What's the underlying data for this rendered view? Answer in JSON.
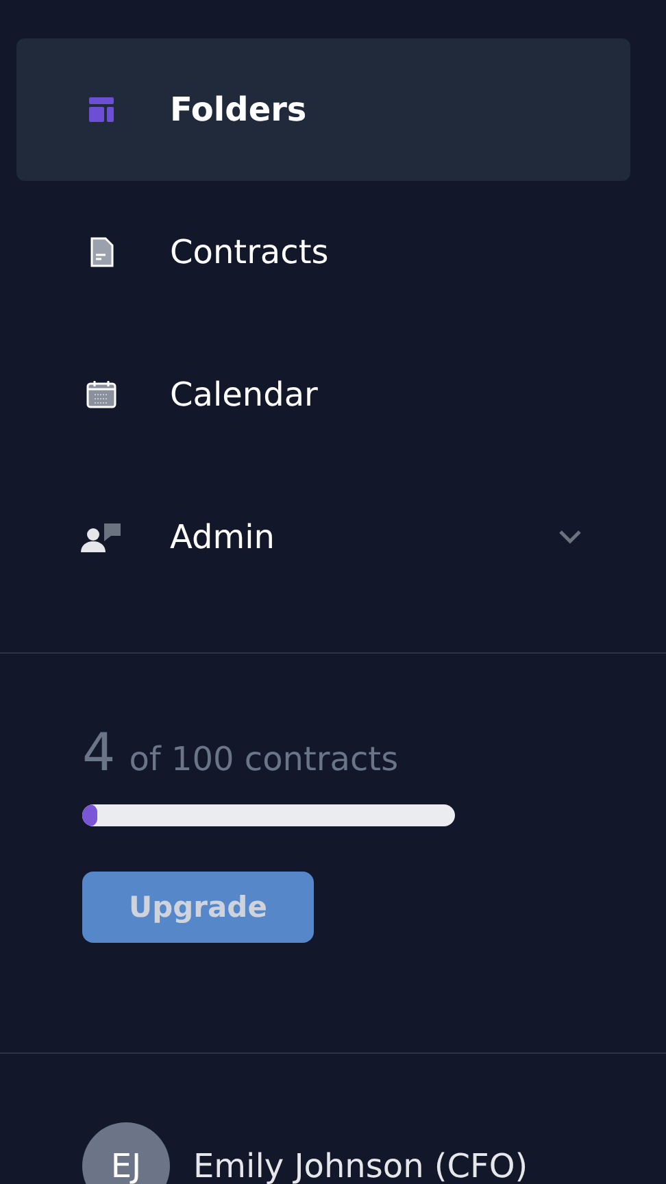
{
  "nav": [
    {
      "label": "Folders",
      "kind": "folders",
      "selected": true
    },
    {
      "label": "Contracts",
      "kind": "document",
      "selected": false
    },
    {
      "label": "Calendar",
      "kind": "calendar",
      "selected": false
    },
    {
      "label": "Admin",
      "kind": "admin",
      "selected": false,
      "expanded": false
    }
  ],
  "usage": {
    "count": "4",
    "text": "of 100 contracts",
    "level": 0.04
  },
  "upgrade_button": "Upgrade",
  "user": {
    "initials": "EJ",
    "name": "Emily Johnson (CFO)"
  }
}
